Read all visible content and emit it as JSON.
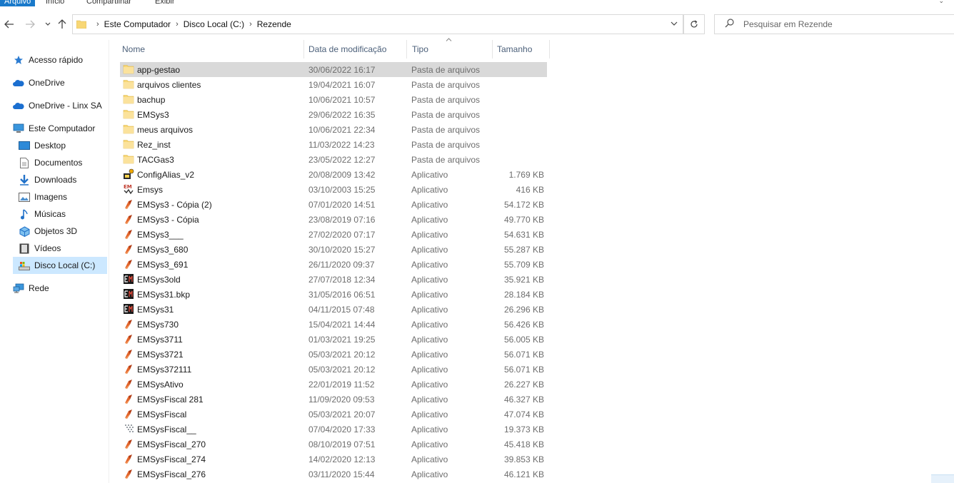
{
  "ribbon": {
    "tabs": [
      "Arquivo",
      "Início",
      "Compartilhar",
      "Exibir"
    ]
  },
  "address": {
    "crumbs": [
      "Este Computador",
      "Disco Local (C:)",
      "Rezende"
    ]
  },
  "search": {
    "placeholder": "Pesquisar em Rezende"
  },
  "sidebar": {
    "items": [
      {
        "label": "Acesso rápido",
        "icon": "star-icon"
      },
      {
        "label": "OneDrive",
        "icon": "cloud-icon"
      },
      {
        "label": "OneDrive - Linx SA",
        "icon": "cloud-icon"
      },
      {
        "label": "Este Computador",
        "icon": "computer-icon"
      },
      {
        "label": "Desktop",
        "icon": "desktop-icon"
      },
      {
        "label": "Documentos",
        "icon": "document-icon"
      },
      {
        "label": "Downloads",
        "icon": "download-icon"
      },
      {
        "label": "Imagens",
        "icon": "image-icon"
      },
      {
        "label": "Músicas",
        "icon": "music-icon"
      },
      {
        "label": "Objetos 3D",
        "icon": "cube-icon"
      },
      {
        "label": "Vídeos",
        "icon": "video-icon"
      },
      {
        "label": "Disco Local (C:)",
        "icon": "drive-icon"
      },
      {
        "label": "Rede",
        "icon": "network-icon"
      }
    ]
  },
  "columns": {
    "name": "Nome",
    "date": "Data de modificação",
    "type": "Tipo",
    "size": "Tamanho"
  },
  "files": [
    {
      "name": "app-gestao",
      "date": "30/06/2022 16:17",
      "type": "Pasta de arquivos",
      "size": "",
      "icon": "folder-icon"
    },
    {
      "name": "arquivos clientes",
      "date": "19/04/2021 16:07",
      "type": "Pasta de arquivos",
      "size": "",
      "icon": "folder-icon"
    },
    {
      "name": "bachup",
      "date": "10/06/2021 10:57",
      "type": "Pasta de arquivos",
      "size": "",
      "icon": "folder-icon"
    },
    {
      "name": "EMSys3",
      "date": "29/06/2022 16:35",
      "type": "Pasta de arquivos",
      "size": "",
      "icon": "folder-icon"
    },
    {
      "name": "meus arquivos",
      "date": "10/06/2021 22:34",
      "type": "Pasta de arquivos",
      "size": "",
      "icon": "folder-icon"
    },
    {
      "name": "Rez_inst",
      "date": "11/03/2022 14:23",
      "type": "Pasta de arquivos",
      "size": "",
      "icon": "folder-icon"
    },
    {
      "name": "TACGas3",
      "date": "23/05/2022 12:27",
      "type": "Pasta de arquivos",
      "size": "",
      "icon": "folder-icon"
    },
    {
      "name": "ConfigAlias_v2",
      "date": "20/08/2009 13:42",
      "type": "Aplicativo",
      "size": "1.769 KB",
      "icon": "config-app-icon"
    },
    {
      "name": "Emsys",
      "date": "03/10/2003 15:25",
      "type": "Aplicativo",
      "size": "416 KB",
      "icon": "em-app-icon"
    },
    {
      "name": "EMSys3 - Cópia (2)",
      "date": "07/01/2020 14:51",
      "type": "Aplicativo",
      "size": "54.172 KB",
      "icon": "emsys-app-icon"
    },
    {
      "name": "EMSys3 - Cópia",
      "date": "23/08/2019 07:16",
      "type": "Aplicativo",
      "size": "49.770 KB",
      "icon": "emsys-app-icon"
    },
    {
      "name": "EMSys3___",
      "date": "27/02/2020 07:17",
      "type": "Aplicativo",
      "size": "54.631 KB",
      "icon": "emsys-app-icon"
    },
    {
      "name": "EMSys3_680",
      "date": "30/10/2020 15:27",
      "type": "Aplicativo",
      "size": "55.287 KB",
      "icon": "emsys-app-icon"
    },
    {
      "name": "EMSys3_691",
      "date": "26/11/2020 09:37",
      "type": "Aplicativo",
      "size": "55.709 KB",
      "icon": "emsys-app-icon"
    },
    {
      "name": "EMSys3old",
      "date": "27/07/2018 12:34",
      "type": "Aplicativo",
      "size": "35.921 KB",
      "icon": "emsys-old-app-icon"
    },
    {
      "name": "EMSys31.bkp",
      "date": "31/05/2016 06:51",
      "type": "Aplicativo",
      "size": "28.184 KB",
      "icon": "emsys-old-app-icon"
    },
    {
      "name": "EMSys31",
      "date": "04/11/2015 07:48",
      "type": "Aplicativo",
      "size": "26.296 KB",
      "icon": "emsys-old-app-icon"
    },
    {
      "name": "EMSys730",
      "date": "15/04/2021 14:44",
      "type": "Aplicativo",
      "size": "56.426 KB",
      "icon": "emsys-app-icon"
    },
    {
      "name": "EMSys3711",
      "date": "01/03/2021 19:25",
      "type": "Aplicativo",
      "size": "56.005 KB",
      "icon": "emsys-app-icon"
    },
    {
      "name": "EMSys3721",
      "date": "05/03/2021 20:12",
      "type": "Aplicativo",
      "size": "56.071 KB",
      "icon": "emsys-app-icon"
    },
    {
      "name": "EMSys372111",
      "date": "05/03/2021 20:12",
      "type": "Aplicativo",
      "size": "56.071 KB",
      "icon": "emsys-app-icon"
    },
    {
      "name": "EMSysAtivo",
      "date": "22/01/2019 11:52",
      "type": "Aplicativo",
      "size": "26.227 KB",
      "icon": "emsys-app-icon"
    },
    {
      "name": "EMSysFiscal 281",
      "date": "11/09/2020 09:53",
      "type": "Aplicativo",
      "size": "46.327 KB",
      "icon": "emsys-app-icon"
    },
    {
      "name": "EMSysFiscal",
      "date": "05/03/2021 20:07",
      "type": "Aplicativo",
      "size": "47.074 KB",
      "icon": "emsys-app-icon"
    },
    {
      "name": "EMSysFiscal__",
      "date": "07/04/2020 17:33",
      "type": "Aplicativo",
      "size": "19.373 KB",
      "icon": "generic-app-icon"
    },
    {
      "name": "EMSysFiscal_270",
      "date": "08/10/2019 07:51",
      "type": "Aplicativo",
      "size": "45.418 KB",
      "icon": "emsys-app-icon"
    },
    {
      "name": "EMSysFiscal_274",
      "date": "14/02/2020 12:13",
      "type": "Aplicativo",
      "size": "39.853 KB",
      "icon": "emsys-app-icon"
    },
    {
      "name": "EMSysFiscal_276",
      "date": "03/11/2020 15:44",
      "type": "Aplicativo",
      "size": "46.121 KB",
      "icon": "emsys-app-icon"
    }
  ],
  "colors": {
    "selected_row": "#d9d9d9",
    "selected_nav": "#cce8ff",
    "header_text": "#4c607a",
    "folder": "#f8d775",
    "accent": "#1979ca"
  }
}
